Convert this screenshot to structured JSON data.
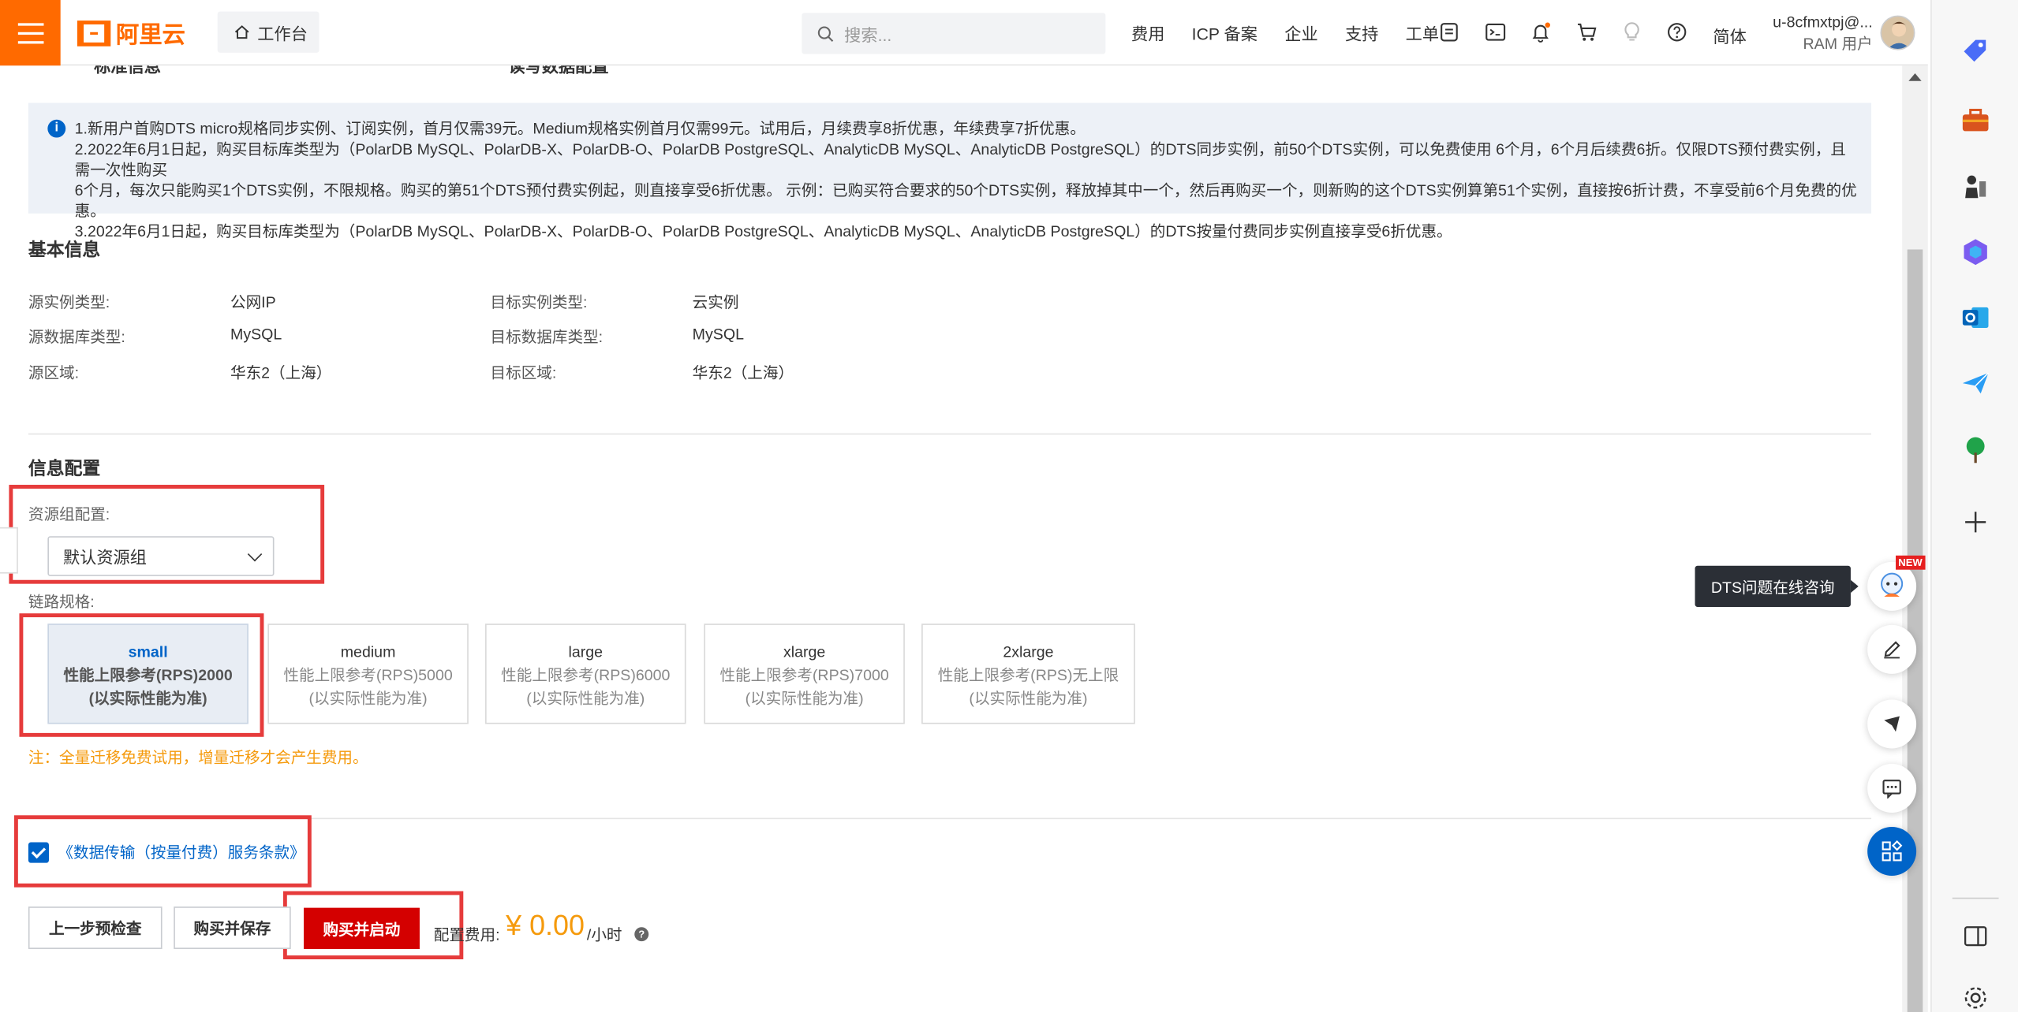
{
  "topbar": {
    "logo_text": "阿里云",
    "workbench_label": "工作台",
    "search_placeholder": "搜索...",
    "nav_links": [
      "费用",
      "ICP 备案",
      "企业",
      "支持",
      "工单"
    ],
    "lang_label": "简体",
    "user_name": "u-8cfmxtpj@...",
    "user_role": "RAM 用户"
  },
  "partial_header": {
    "left": "标准信息",
    "right": "读写数据配置"
  },
  "notice": {
    "line1": "1.新用户首购DTS micro规格同步实例、订阅实例，首月仅需39元。Medium规格实例首月仅需99元。试用后，月续费享8折优惠，年续费享7折优惠。",
    "line2a": "2.2022年6月1日起，购买目标库类型为（PolarDB MySQL、PolarDB-X、PolarDB-O、PolarDB PostgreSQL、AnalyticDB MySQL、AnalyticDB PostgreSQL）的DTS同步实例，前50个DTS实例，可以免费使用 6个月，6个月后续费6折。仅限DTS预付费实例，且需一次性购买",
    "line2b": "6个月，每次只能购买1个DTS实例，不限规格。购买的第51个DTS预付费实例起，则直接享受6折优惠。 示例：已购买符合要求的50个DTS实例，释放掉其中一个，然后再购买一个，则新购的这个DTS实例算第51个实例，直接按6折计费，不享受前6个月免费的优惠。",
    "line3": "3.2022年6月1日起，购买目标库类型为（PolarDB MySQL、PolarDB-X、PolarDB-O、PolarDB PostgreSQL、AnalyticDB MySQL、AnalyticDB PostgreSQL）的DTS按量付费同步实例直接享受6折优惠。"
  },
  "basic_info": {
    "title": "基本信息",
    "fields": [
      {
        "label": "源实例类型:",
        "value": "公网IP"
      },
      {
        "label": "源数据库类型:",
        "value": "MySQL"
      },
      {
        "label": "源区域:",
        "value": "华东2（上海）"
      },
      {
        "label": "目标实例类型:",
        "value": "云实例"
      },
      {
        "label": "目标数据库类型:",
        "value": "MySQL"
      },
      {
        "label": "目标区域:",
        "value": "华东2（上海）"
      }
    ]
  },
  "config": {
    "title": "信息配置",
    "resource_group_label": "资源组配置:",
    "resource_group_value": "默认资源组",
    "link_spec_label": "链路规格:",
    "specs": [
      {
        "name": "small",
        "line1": "性能上限参考(RPS)2000",
        "line2": "(以实际性能为准)",
        "selected": true
      },
      {
        "name": "medium",
        "line1": "性能上限参考(RPS)5000",
        "line2": "(以实际性能为准)",
        "selected": false
      },
      {
        "name": "large",
        "line1": "性能上限参考(RPS)6000",
        "line2": "(以实际性能为准)",
        "selected": false
      },
      {
        "name": "xlarge",
        "line1": "性能上限参考(RPS)7000",
        "line2": "(以实际性能为准)",
        "selected": false
      },
      {
        "name": "2xlarge",
        "line1": "性能上限参考(RPS)无上限",
        "line2": "(以实际性能为准)",
        "selected": false
      }
    ],
    "note": "注：全量迁移免费试用，增量迁移才会产生费用。"
  },
  "terms": {
    "checked": true,
    "text": "《数据传输（按量付费）服务条款》"
  },
  "actions": {
    "prev_label": "上一步预检查",
    "buy_save_label": "购买并保存",
    "buy_start_label": "购买并启动",
    "fee_label": "配置费用:",
    "fee_value": "¥ 0.00",
    "fee_unit": "/小时"
  },
  "float_tools": {
    "tooltip": "DTS问题在线咨询",
    "new_badge": "NEW"
  },
  "colors": {
    "brand": "#ff6a00",
    "primary_blue": "#0064c8",
    "danger_red": "#d40000",
    "highlight_box": "#e63b3b",
    "fee_orange": "#f59a0c"
  }
}
